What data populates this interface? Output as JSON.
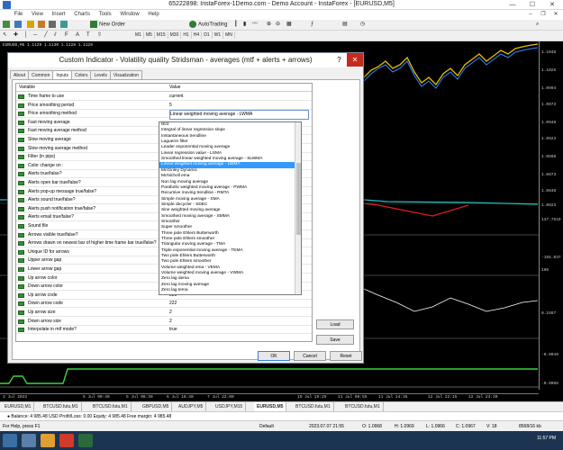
{
  "window": {
    "title": "65222898: InstaForex-1Demo.com - Demo Account - InstaForex - [EURUSD,M5]",
    "min": "—",
    "max": "☐",
    "close": "✕"
  },
  "menu": [
    "File",
    "View",
    "Insert",
    "Charts",
    "Tools",
    "Window",
    "Help"
  ],
  "toolbar": {
    "new_order": "New Order",
    "autotrading": "AutoTrading",
    "timeframes": [
      "M1",
      "M5",
      "M15",
      "M30",
      "H1",
      "H4",
      "D1",
      "W1",
      "MN"
    ]
  },
  "chart": {
    "label": "EURUSD,M5  1.1129 1.1130 1.1128 1.1129",
    "prices": [
      "1.1048",
      "1.1025",
      "1.0994",
      "1.0973",
      "1.0948",
      "1.0923",
      "1.0898",
      "1.0873",
      "1.0848",
      "1.0823",
      "137.7519",
      "-155.037",
      "105",
      "0.2467",
      "-0.0049",
      "-0.0068"
    ],
    "times": [
      "3 Jul 2023",
      "5 Jul 00:40",
      "5 Jul 08:30",
      "6 Jul 16:40",
      "7 Jul 22:00",
      "10 Jul 19:25",
      "11 Jul 08:55",
      "11 Jul 14:35",
      "12 Jul 22:15",
      "12 Jul 23:30",
      "12 Jul 18:35"
    ]
  },
  "tabs": [
    "EURUSD,M1",
    "BTCUSD.futu,M1",
    "BTCUSD.futu,M1",
    "GBPUSD,M5",
    "AUDJPY,M5",
    "USDJPY,M15",
    "EURUSD,M5",
    "BTCUSD.futu,M1",
    "BTCUSD.futu,M1"
  ],
  "trade": "● Balance: 4 985.48 USD  Profit/Loss: 0.00  Equity: 4 985.48  Free margin: 4 985.48",
  "status": {
    "help": "For Help, press F1",
    "profile": "Default",
    "datetime": "2023.07.07 21:55",
    "o": "O: 1.0968",
    "h": "H: 1.0969",
    "l": "L: 1.0966",
    "c": "C: 1.0967",
    "v": "V: 18",
    "traffic": "8568/16 kb",
    "clock": "11:57 PM"
  },
  "dialog": {
    "title": "Custom Indicator - Volatility quality Stridsman - averages (mtf + alerts + arrows)",
    "help": "?",
    "close": "✕",
    "tabs": [
      "About",
      "Common",
      "Inputs",
      "Colors",
      "Levels",
      "Visualization"
    ],
    "col_variable": "Variable",
    "col_value": "Value",
    "rows": [
      {
        "name": "Time frame to use",
        "value": "current"
      },
      {
        "name": "Price smoothing period",
        "value": "5"
      },
      {
        "name": "Price smoothing method",
        "value": "Linear weighted moving average - LWMA"
      },
      {
        "name": "Fast moving average",
        "value": ""
      },
      {
        "name": "Fast moving average method",
        "value": ""
      },
      {
        "name": "Slow moving average",
        "value": ""
      },
      {
        "name": "Slow moving average method",
        "value": ""
      },
      {
        "name": "Filter (in pips)",
        "value": ""
      },
      {
        "name": "Color change on :",
        "value": ""
      },
      {
        "name": "Alerts true/false?",
        "value": ""
      },
      {
        "name": "Alerts open bar true/false?",
        "value": ""
      },
      {
        "name": "Alerts pop-up message true/false?",
        "value": ""
      },
      {
        "name": "Alerts sound true/false?",
        "value": ""
      },
      {
        "name": "Alerts push notification true/false?",
        "value": ""
      },
      {
        "name": "Alerts email true/false?",
        "value": ""
      },
      {
        "name": "Sound file",
        "value": ""
      },
      {
        "name": "Arrows visible true/false?",
        "value": ""
      },
      {
        "name": "Arrows drawn on newest bar of higher time frame bar true/false?",
        "value": ""
      },
      {
        "name": "Unique ID for arrows",
        "value": ""
      },
      {
        "name": "Upper arrow gap",
        "value": ""
      },
      {
        "name": "Lower arrow gap",
        "value": ""
      },
      {
        "name": "Up arrow color",
        "value": ""
      },
      {
        "name": "Down arrow color",
        "value": ""
      },
      {
        "name": "Up arrow code",
        "value": "221"
      },
      {
        "name": "Down arrow code",
        "value": "222"
      },
      {
        "name": "Up arrow size",
        "value": "2"
      },
      {
        "name": "Down arrow size",
        "value": "2"
      },
      {
        "name": "Interpolate in mtf mode?",
        "value": "true"
      }
    ],
    "options": [
      "IE/2",
      "Integral of linear regression slope",
      "Instantaneous trendline",
      "Laguerre filter",
      "Leader exponential moving average",
      "Linear regression value - LSMA",
      "Smoothed linear weighted moving average - SLWMA",
      "Linear weighted moving average - LWMA",
      "McGinley Dynamic",
      "McNicholl ema",
      "Non lag moving average",
      "Parabolic weighted moving average - PWMA",
      "Recursive moving trendline - RMTA",
      "Simple moving average - SMA",
      "Simple decycler - SDEC",
      "Sine weighted moving average",
      "Smoothed moving average - SMMA",
      "Smoother",
      "Super smoother",
      "Three pole Ehlers Butterworth",
      "Three pole Ehlers smoother",
      "Triangular moving average - TMA",
      "Triple exponential moving average - TEMA",
      "Two pole Ehlers Butterworth",
      "Two pole Ehlers smoother",
      "Volume weighted ema - VEMA",
      "Volume weighted moving average - VWMA",
      "Zero lag dema",
      "Zero lag moving average",
      "Zero lag tema"
    ],
    "selected_option": "Linear weighted moving average - LWMA",
    "load": "Load",
    "save": "Save",
    "ok": "OK",
    "cancel": "Cancel",
    "reset": "Reset"
  }
}
